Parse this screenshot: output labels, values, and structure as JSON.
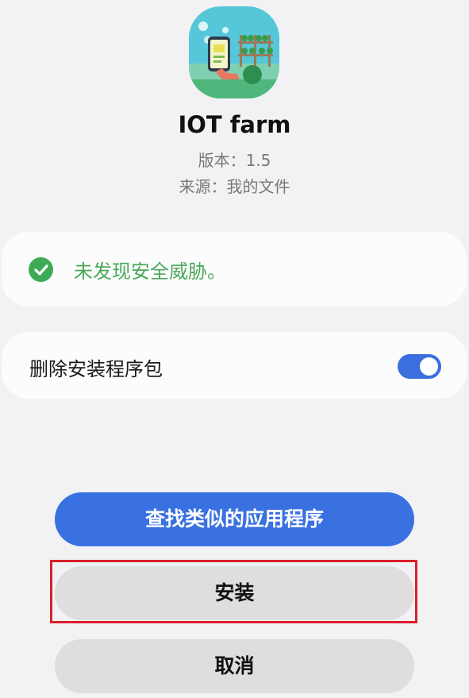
{
  "app": {
    "name": "IOT farm",
    "version_line": "版本：1.5",
    "source_line": "来源：我的文件",
    "icon": "iot-farm-app-icon"
  },
  "security": {
    "status_text": "未发现安全威胁。",
    "icon": "check-circle-icon",
    "color": "#4aa858"
  },
  "options": {
    "delete_package_label": "删除安装程序包",
    "delete_package_enabled": true
  },
  "buttons": {
    "find_similar": "查找类似的应用程序",
    "install": "安装",
    "cancel": "取消"
  },
  "colors": {
    "accent": "#3a71e1",
    "highlight": "#d9202b",
    "success": "#3dab55"
  }
}
